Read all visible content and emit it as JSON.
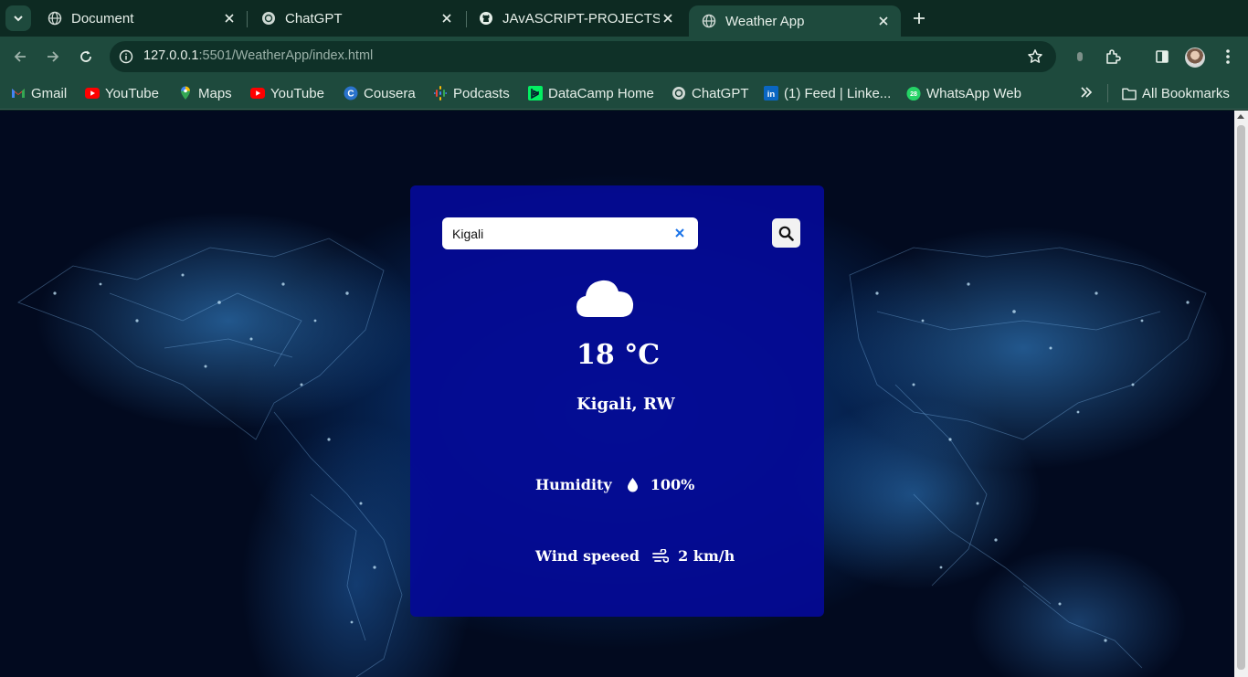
{
  "browser": {
    "tabs": [
      {
        "title": "Document",
        "icon": "globe-icon",
        "active": false
      },
      {
        "title": "ChatGPT",
        "icon": "chatgpt-icon",
        "active": false
      },
      {
        "title": "JAvASCRIPT-PROJECTS/C",
        "icon": "github-icon",
        "active": false
      },
      {
        "title": "Weather App",
        "icon": "globe-icon",
        "active": true
      }
    ],
    "url_host": "127.0.0.1",
    "url_rest": ":5501/WeatherApp/index.html",
    "bookmarks": [
      {
        "label": "Gmail",
        "icon": "gmail-icon"
      },
      {
        "label": "YouTube",
        "icon": "youtube-icon"
      },
      {
        "label": "Maps",
        "icon": "maps-icon"
      },
      {
        "label": "YouTube",
        "icon": "youtube-icon"
      },
      {
        "label": "Cousera",
        "icon": "coursera-icon"
      },
      {
        "label": "Podcasts",
        "icon": "podcasts-icon"
      },
      {
        "label": "DataCamp Home",
        "icon": "datacamp-icon"
      },
      {
        "label": "ChatGPT",
        "icon": "chatgpt-icon"
      },
      {
        "label": "(1) Feed | Linke...",
        "icon": "linkedin-icon"
      },
      {
        "label": "WhatsApp Web",
        "icon": "whatsapp-icon"
      }
    ],
    "all_bookmarks_label": "All Bookmarks",
    "whatsapp_badge": "28"
  },
  "weather": {
    "search_value": "Kigali",
    "temperature": "18 °C",
    "location": "Kigali, RW",
    "humidity_label": "Humidity",
    "humidity_value": "100%",
    "wind_label": "Wind speeed",
    "wind_value": "2 km/h",
    "condition_icon": "cloud-icon"
  },
  "colors": {
    "card_bg": "#040a96",
    "browser_frame": "#1e4a3d"
  }
}
